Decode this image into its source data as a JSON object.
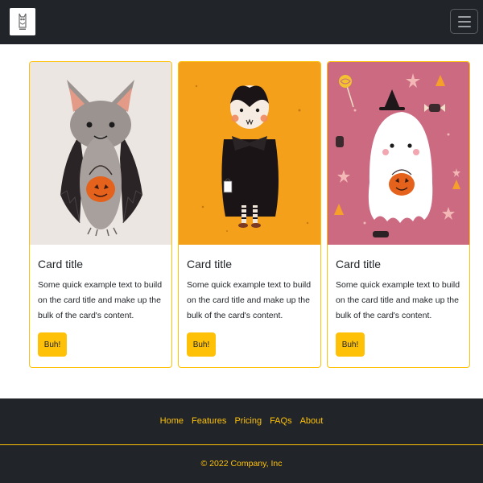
{
  "navbar": {
    "brand_icon": "owl-logo-icon",
    "toggler_icon": "hamburger-menu-icon"
  },
  "cards": [
    {
      "image": "bat-with-pumpkin-bucket-illustration",
      "title": "Card title",
      "text": "Some quick example text to build on the card title and make up the bulk of the card's content.",
      "button_label": "Buh!"
    },
    {
      "image": "vampire-child-illustration",
      "title": "Card title",
      "text": "Some quick example text to build on the card title and make up the bulk of the card's content.",
      "button_label": "Buh!"
    },
    {
      "image": "ghost-with-pumpkin-illustration",
      "title": "Card title",
      "text": "Some quick example text to build on the card title and make up the bulk of the card's content.",
      "button_label": "Buh!"
    }
  ],
  "footer": {
    "links": [
      "Home",
      "Features",
      "Pricing",
      "FAQs",
      "About"
    ],
    "copyright": "© 2022 Company, Inc"
  },
  "colors": {
    "dark": "#212529",
    "accent": "#ffc107",
    "card_border": "#ffc107"
  }
}
